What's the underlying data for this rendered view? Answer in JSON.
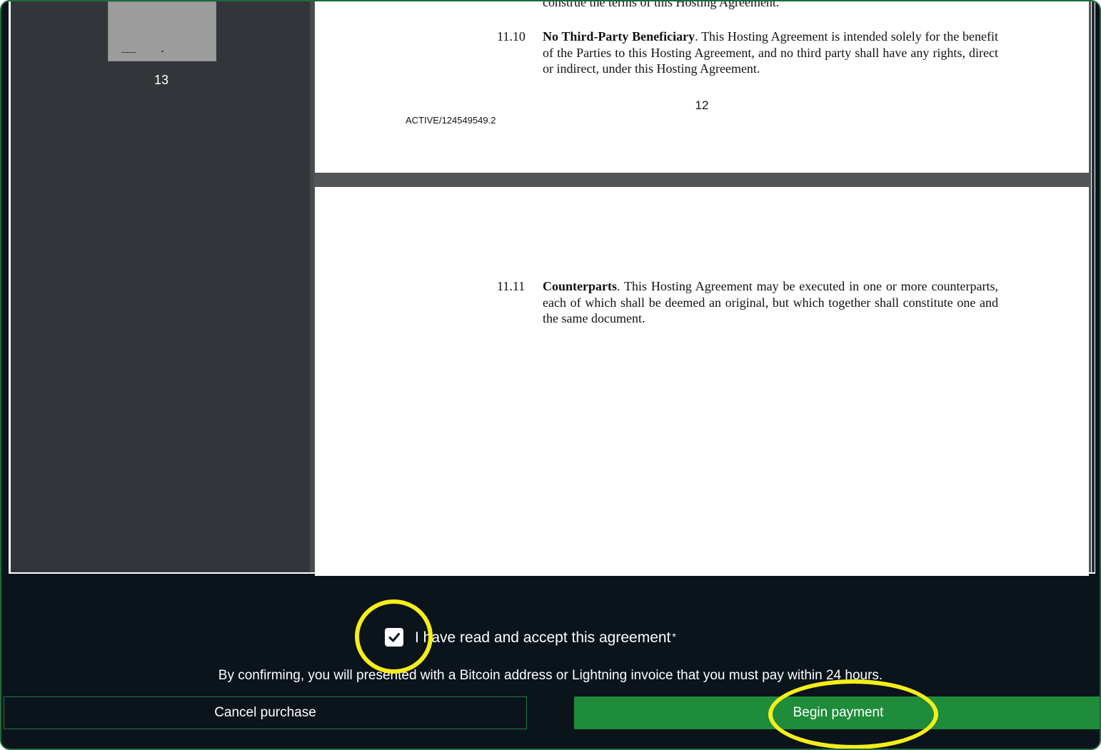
{
  "viewer": {
    "thumbnail_page_label": "13",
    "page1": {
      "top_fragment": "construe the terms of this Hosting Agreement.",
      "clause_number": "11.10",
      "clause_heading": "No Third-Party Beneficiary",
      "clause_body": ". This Hosting Agreement is intended solely for the benefit of the Parties to this Hosting Agreement, and no third party shall have any rights, direct or indirect, under this Hosting Agreement.",
      "page_number": "12",
      "doc_id": "ACTIVE/124549549.2"
    },
    "page2": {
      "clause_number": "11.11",
      "clause_heading": "Counterparts",
      "clause_body": ". This Hosting Agreement may be executed in one or more counterparts, each of which shall be deemed an original, but which together shall constitute one and the same document."
    }
  },
  "agreement": {
    "checked": true,
    "label": "I have read and accept this agreement",
    "required_marker": "*",
    "notice": "By confirming, you will presented with a Bitcoin address or Lightning invoice that you must pay within 24 hours."
  },
  "actions": {
    "cancel_label": "Cancel purchase",
    "begin_label": "Begin payment"
  },
  "colors": {
    "footer_bg": "#0b131b",
    "primary_green": "#1e8c3a",
    "highlight_yellow": "#f5ee1a",
    "sidebar_bg": "#32363a"
  },
  "icons": {
    "checkbox": "checkmark-icon"
  }
}
